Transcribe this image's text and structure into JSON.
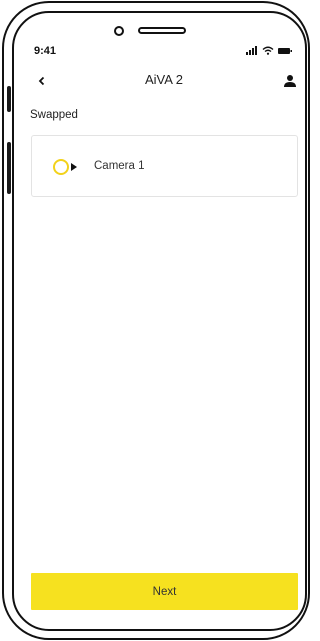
{
  "status_bar": {
    "time": "9:41",
    "icons": [
      "signal-icon",
      "wifi-icon",
      "battery-icon"
    ]
  },
  "nav": {
    "title": "AiVA 2",
    "back_icon": "chevron-left-icon",
    "profile_icon": "user-icon"
  },
  "section": {
    "label": "Swapped"
  },
  "camera": {
    "label": "Camera 1",
    "icon": "camera-icon"
  },
  "footer": {
    "next_label": "Next"
  },
  "colors": {
    "accent": "#f6e11f",
    "camera_ring": "#f2d21b",
    "frame": "#111111"
  }
}
